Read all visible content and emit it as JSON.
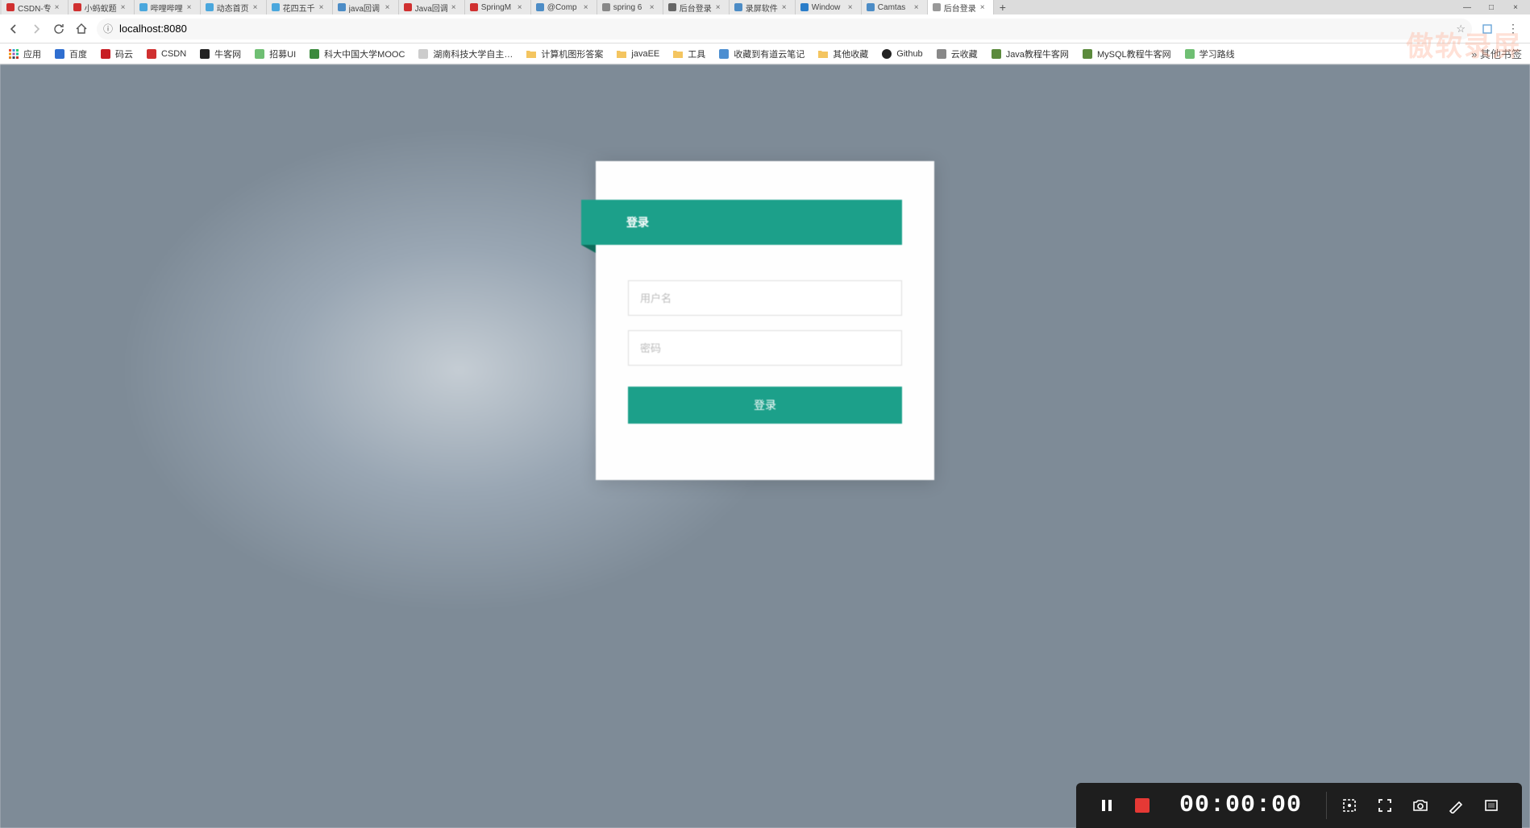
{
  "browser": {
    "tabs": [
      {
        "title": "CSDN-专",
        "favicon": "#d03030"
      },
      {
        "title": "小蚂蚁题",
        "favicon": "#d03030"
      },
      {
        "title": "哔哩哔哩",
        "favicon": "#4aa7dd"
      },
      {
        "title": "动态首页",
        "favicon": "#4aa7dd"
      },
      {
        "title": "花四五千",
        "favicon": "#4aa7dd"
      },
      {
        "title": "java回调",
        "favicon": "#4c8cc6"
      },
      {
        "title": "Java回调",
        "favicon": "#d03030"
      },
      {
        "title": "SpringM",
        "favicon": "#d03030"
      },
      {
        "title": "@Comp",
        "favicon": "#4c8cc6"
      },
      {
        "title": "spring 6",
        "favicon": "#888888"
      },
      {
        "title": "后台登录",
        "favicon": "#666666"
      },
      {
        "title": "录屏软件",
        "favicon": "#4c8cc6"
      },
      {
        "title": "Window",
        "favicon": "#2a7dc9"
      },
      {
        "title": "Camtas",
        "favicon": "#4c8cc6"
      },
      {
        "title": "后台登录",
        "favicon": "#999999",
        "active": true
      }
    ],
    "url": "localhost:8080",
    "bookmarks": [
      {
        "label": "应用",
        "icon": "apps"
      },
      {
        "label": "百度",
        "icon": "baidu"
      },
      {
        "label": "码云",
        "icon": "gitee"
      },
      {
        "label": "CSDN",
        "icon": "csdn"
      },
      {
        "label": "牛客网",
        "icon": "nowcoder"
      },
      {
        "label": "招募UI",
        "icon": "ui"
      },
      {
        "label": "科大中国大学MOOC",
        "icon": "mooc"
      },
      {
        "label": "湖南科技大学自主…",
        "icon": "blank"
      },
      {
        "label": "计算机图形答案",
        "icon": "folder"
      },
      {
        "label": "javaEE",
        "icon": "folder"
      },
      {
        "label": "工具",
        "icon": "folder"
      },
      {
        "label": "收藏到有道云笔记",
        "icon": "note"
      },
      {
        "label": "其他收藏",
        "icon": "folder"
      },
      {
        "label": "Github",
        "icon": "github"
      },
      {
        "label": "云收藏",
        "icon": "cloud"
      },
      {
        "label": "Java教程牛客网",
        "icon": "java"
      },
      {
        "label": "MySQL教程牛客网",
        "icon": "mysql"
      },
      {
        "label": "学习路线",
        "icon": "route"
      }
    ],
    "bookmarks_overflow": "其他书签"
  },
  "login": {
    "header": "登录",
    "username_placeholder": "用户名",
    "password_placeholder": "密码",
    "submit_label": "登录"
  },
  "watermark": "傲软录屏",
  "recorder": {
    "time": "00:00:00"
  }
}
